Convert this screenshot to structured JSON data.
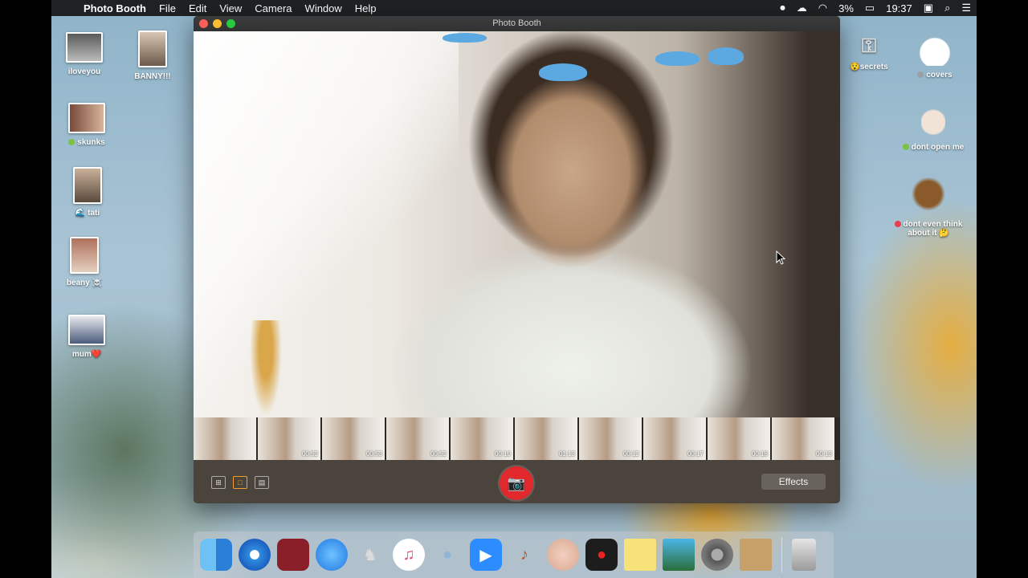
{
  "menubar": {
    "apple": "",
    "app_name": "Photo Booth",
    "menus": [
      "File",
      "Edit",
      "View",
      "Camera",
      "Window",
      "Help"
    ],
    "battery": "3%",
    "clock": "19:37"
  },
  "desktop_icons_left": [
    {
      "label": "iloveyou"
    },
    {
      "label": "BANNY!!!"
    },
    {
      "label": "skunks"
    },
    {
      "label": "tati"
    },
    {
      "label": "beany ☠️"
    },
    {
      "label": "mum❤️"
    }
  ],
  "desktop_icons_right": [
    {
      "label": "secrets"
    },
    {
      "label": "covers"
    },
    {
      "label": "dont open me"
    },
    {
      "label": "dont even think about it 🤔"
    }
  ],
  "window": {
    "title": "Photo Booth",
    "filmstrip_badges": [
      "",
      "00:52",
      "00:53",
      "00:52",
      "00:10",
      "01:13",
      "00:12",
      "00:17",
      "00:18",
      "00:13"
    ],
    "effects_label": "Effects"
  },
  "dock": {
    "apps": [
      "Finder",
      "Safari",
      "Photo Booth",
      "Messages",
      "Tux",
      "iTunes",
      "Seal",
      "Zoom",
      "GarageBand",
      "Face",
      "Photo Booth Red",
      "Stickies",
      "Preview",
      "System Preferences",
      "Contacts"
    ],
    "trash": "Trash"
  }
}
